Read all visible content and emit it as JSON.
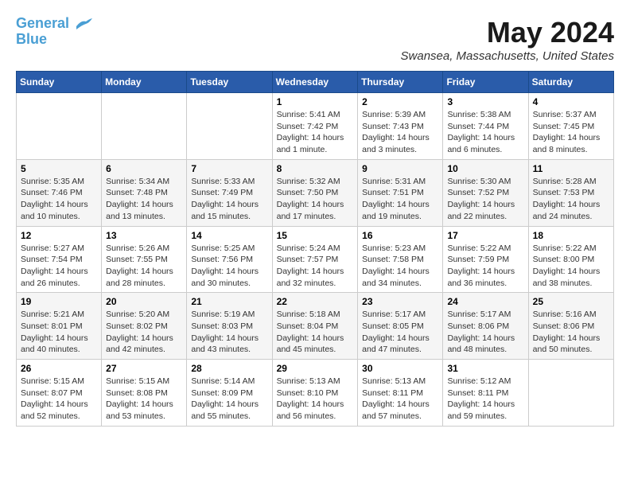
{
  "logo": {
    "line1": "General",
    "line2": "Blue"
  },
  "title": "May 2024",
  "location": "Swansea, Massachusetts, United States",
  "days_of_week": [
    "Sunday",
    "Monday",
    "Tuesday",
    "Wednesday",
    "Thursday",
    "Friday",
    "Saturday"
  ],
  "weeks": [
    [
      {
        "day": "",
        "sunrise": "",
        "sunset": "",
        "daylight": ""
      },
      {
        "day": "",
        "sunrise": "",
        "sunset": "",
        "daylight": ""
      },
      {
        "day": "",
        "sunrise": "",
        "sunset": "",
        "daylight": ""
      },
      {
        "day": "1",
        "sunrise": "Sunrise: 5:41 AM",
        "sunset": "Sunset: 7:42 PM",
        "daylight": "Daylight: 14 hours and 1 minute."
      },
      {
        "day": "2",
        "sunrise": "Sunrise: 5:39 AM",
        "sunset": "Sunset: 7:43 PM",
        "daylight": "Daylight: 14 hours and 3 minutes."
      },
      {
        "day": "3",
        "sunrise": "Sunrise: 5:38 AM",
        "sunset": "Sunset: 7:44 PM",
        "daylight": "Daylight: 14 hours and 6 minutes."
      },
      {
        "day": "4",
        "sunrise": "Sunrise: 5:37 AM",
        "sunset": "Sunset: 7:45 PM",
        "daylight": "Daylight: 14 hours and 8 minutes."
      }
    ],
    [
      {
        "day": "5",
        "sunrise": "Sunrise: 5:35 AM",
        "sunset": "Sunset: 7:46 PM",
        "daylight": "Daylight: 14 hours and 10 minutes."
      },
      {
        "day": "6",
        "sunrise": "Sunrise: 5:34 AM",
        "sunset": "Sunset: 7:48 PM",
        "daylight": "Daylight: 14 hours and 13 minutes."
      },
      {
        "day": "7",
        "sunrise": "Sunrise: 5:33 AM",
        "sunset": "Sunset: 7:49 PM",
        "daylight": "Daylight: 14 hours and 15 minutes."
      },
      {
        "day": "8",
        "sunrise": "Sunrise: 5:32 AM",
        "sunset": "Sunset: 7:50 PM",
        "daylight": "Daylight: 14 hours and 17 minutes."
      },
      {
        "day": "9",
        "sunrise": "Sunrise: 5:31 AM",
        "sunset": "Sunset: 7:51 PM",
        "daylight": "Daylight: 14 hours and 19 minutes."
      },
      {
        "day": "10",
        "sunrise": "Sunrise: 5:30 AM",
        "sunset": "Sunset: 7:52 PM",
        "daylight": "Daylight: 14 hours and 22 minutes."
      },
      {
        "day": "11",
        "sunrise": "Sunrise: 5:28 AM",
        "sunset": "Sunset: 7:53 PM",
        "daylight": "Daylight: 14 hours and 24 minutes."
      }
    ],
    [
      {
        "day": "12",
        "sunrise": "Sunrise: 5:27 AM",
        "sunset": "Sunset: 7:54 PM",
        "daylight": "Daylight: 14 hours and 26 minutes."
      },
      {
        "day": "13",
        "sunrise": "Sunrise: 5:26 AM",
        "sunset": "Sunset: 7:55 PM",
        "daylight": "Daylight: 14 hours and 28 minutes."
      },
      {
        "day": "14",
        "sunrise": "Sunrise: 5:25 AM",
        "sunset": "Sunset: 7:56 PM",
        "daylight": "Daylight: 14 hours and 30 minutes."
      },
      {
        "day": "15",
        "sunrise": "Sunrise: 5:24 AM",
        "sunset": "Sunset: 7:57 PM",
        "daylight": "Daylight: 14 hours and 32 minutes."
      },
      {
        "day": "16",
        "sunrise": "Sunrise: 5:23 AM",
        "sunset": "Sunset: 7:58 PM",
        "daylight": "Daylight: 14 hours and 34 minutes."
      },
      {
        "day": "17",
        "sunrise": "Sunrise: 5:22 AM",
        "sunset": "Sunset: 7:59 PM",
        "daylight": "Daylight: 14 hours and 36 minutes."
      },
      {
        "day": "18",
        "sunrise": "Sunrise: 5:22 AM",
        "sunset": "Sunset: 8:00 PM",
        "daylight": "Daylight: 14 hours and 38 minutes."
      }
    ],
    [
      {
        "day": "19",
        "sunrise": "Sunrise: 5:21 AM",
        "sunset": "Sunset: 8:01 PM",
        "daylight": "Daylight: 14 hours and 40 minutes."
      },
      {
        "day": "20",
        "sunrise": "Sunrise: 5:20 AM",
        "sunset": "Sunset: 8:02 PM",
        "daylight": "Daylight: 14 hours and 42 minutes."
      },
      {
        "day": "21",
        "sunrise": "Sunrise: 5:19 AM",
        "sunset": "Sunset: 8:03 PM",
        "daylight": "Daylight: 14 hours and 43 minutes."
      },
      {
        "day": "22",
        "sunrise": "Sunrise: 5:18 AM",
        "sunset": "Sunset: 8:04 PM",
        "daylight": "Daylight: 14 hours and 45 minutes."
      },
      {
        "day": "23",
        "sunrise": "Sunrise: 5:17 AM",
        "sunset": "Sunset: 8:05 PM",
        "daylight": "Daylight: 14 hours and 47 minutes."
      },
      {
        "day": "24",
        "sunrise": "Sunrise: 5:17 AM",
        "sunset": "Sunset: 8:06 PM",
        "daylight": "Daylight: 14 hours and 48 minutes."
      },
      {
        "day": "25",
        "sunrise": "Sunrise: 5:16 AM",
        "sunset": "Sunset: 8:06 PM",
        "daylight": "Daylight: 14 hours and 50 minutes."
      }
    ],
    [
      {
        "day": "26",
        "sunrise": "Sunrise: 5:15 AM",
        "sunset": "Sunset: 8:07 PM",
        "daylight": "Daylight: 14 hours and 52 minutes."
      },
      {
        "day": "27",
        "sunrise": "Sunrise: 5:15 AM",
        "sunset": "Sunset: 8:08 PM",
        "daylight": "Daylight: 14 hours and 53 minutes."
      },
      {
        "day": "28",
        "sunrise": "Sunrise: 5:14 AM",
        "sunset": "Sunset: 8:09 PM",
        "daylight": "Daylight: 14 hours and 55 minutes."
      },
      {
        "day": "29",
        "sunrise": "Sunrise: 5:13 AM",
        "sunset": "Sunset: 8:10 PM",
        "daylight": "Daylight: 14 hours and 56 minutes."
      },
      {
        "day": "30",
        "sunrise": "Sunrise: 5:13 AM",
        "sunset": "Sunset: 8:11 PM",
        "daylight": "Daylight: 14 hours and 57 minutes."
      },
      {
        "day": "31",
        "sunrise": "Sunrise: 5:12 AM",
        "sunset": "Sunset: 8:11 PM",
        "daylight": "Daylight: 14 hours and 59 minutes."
      },
      {
        "day": "",
        "sunrise": "",
        "sunset": "",
        "daylight": ""
      }
    ]
  ]
}
